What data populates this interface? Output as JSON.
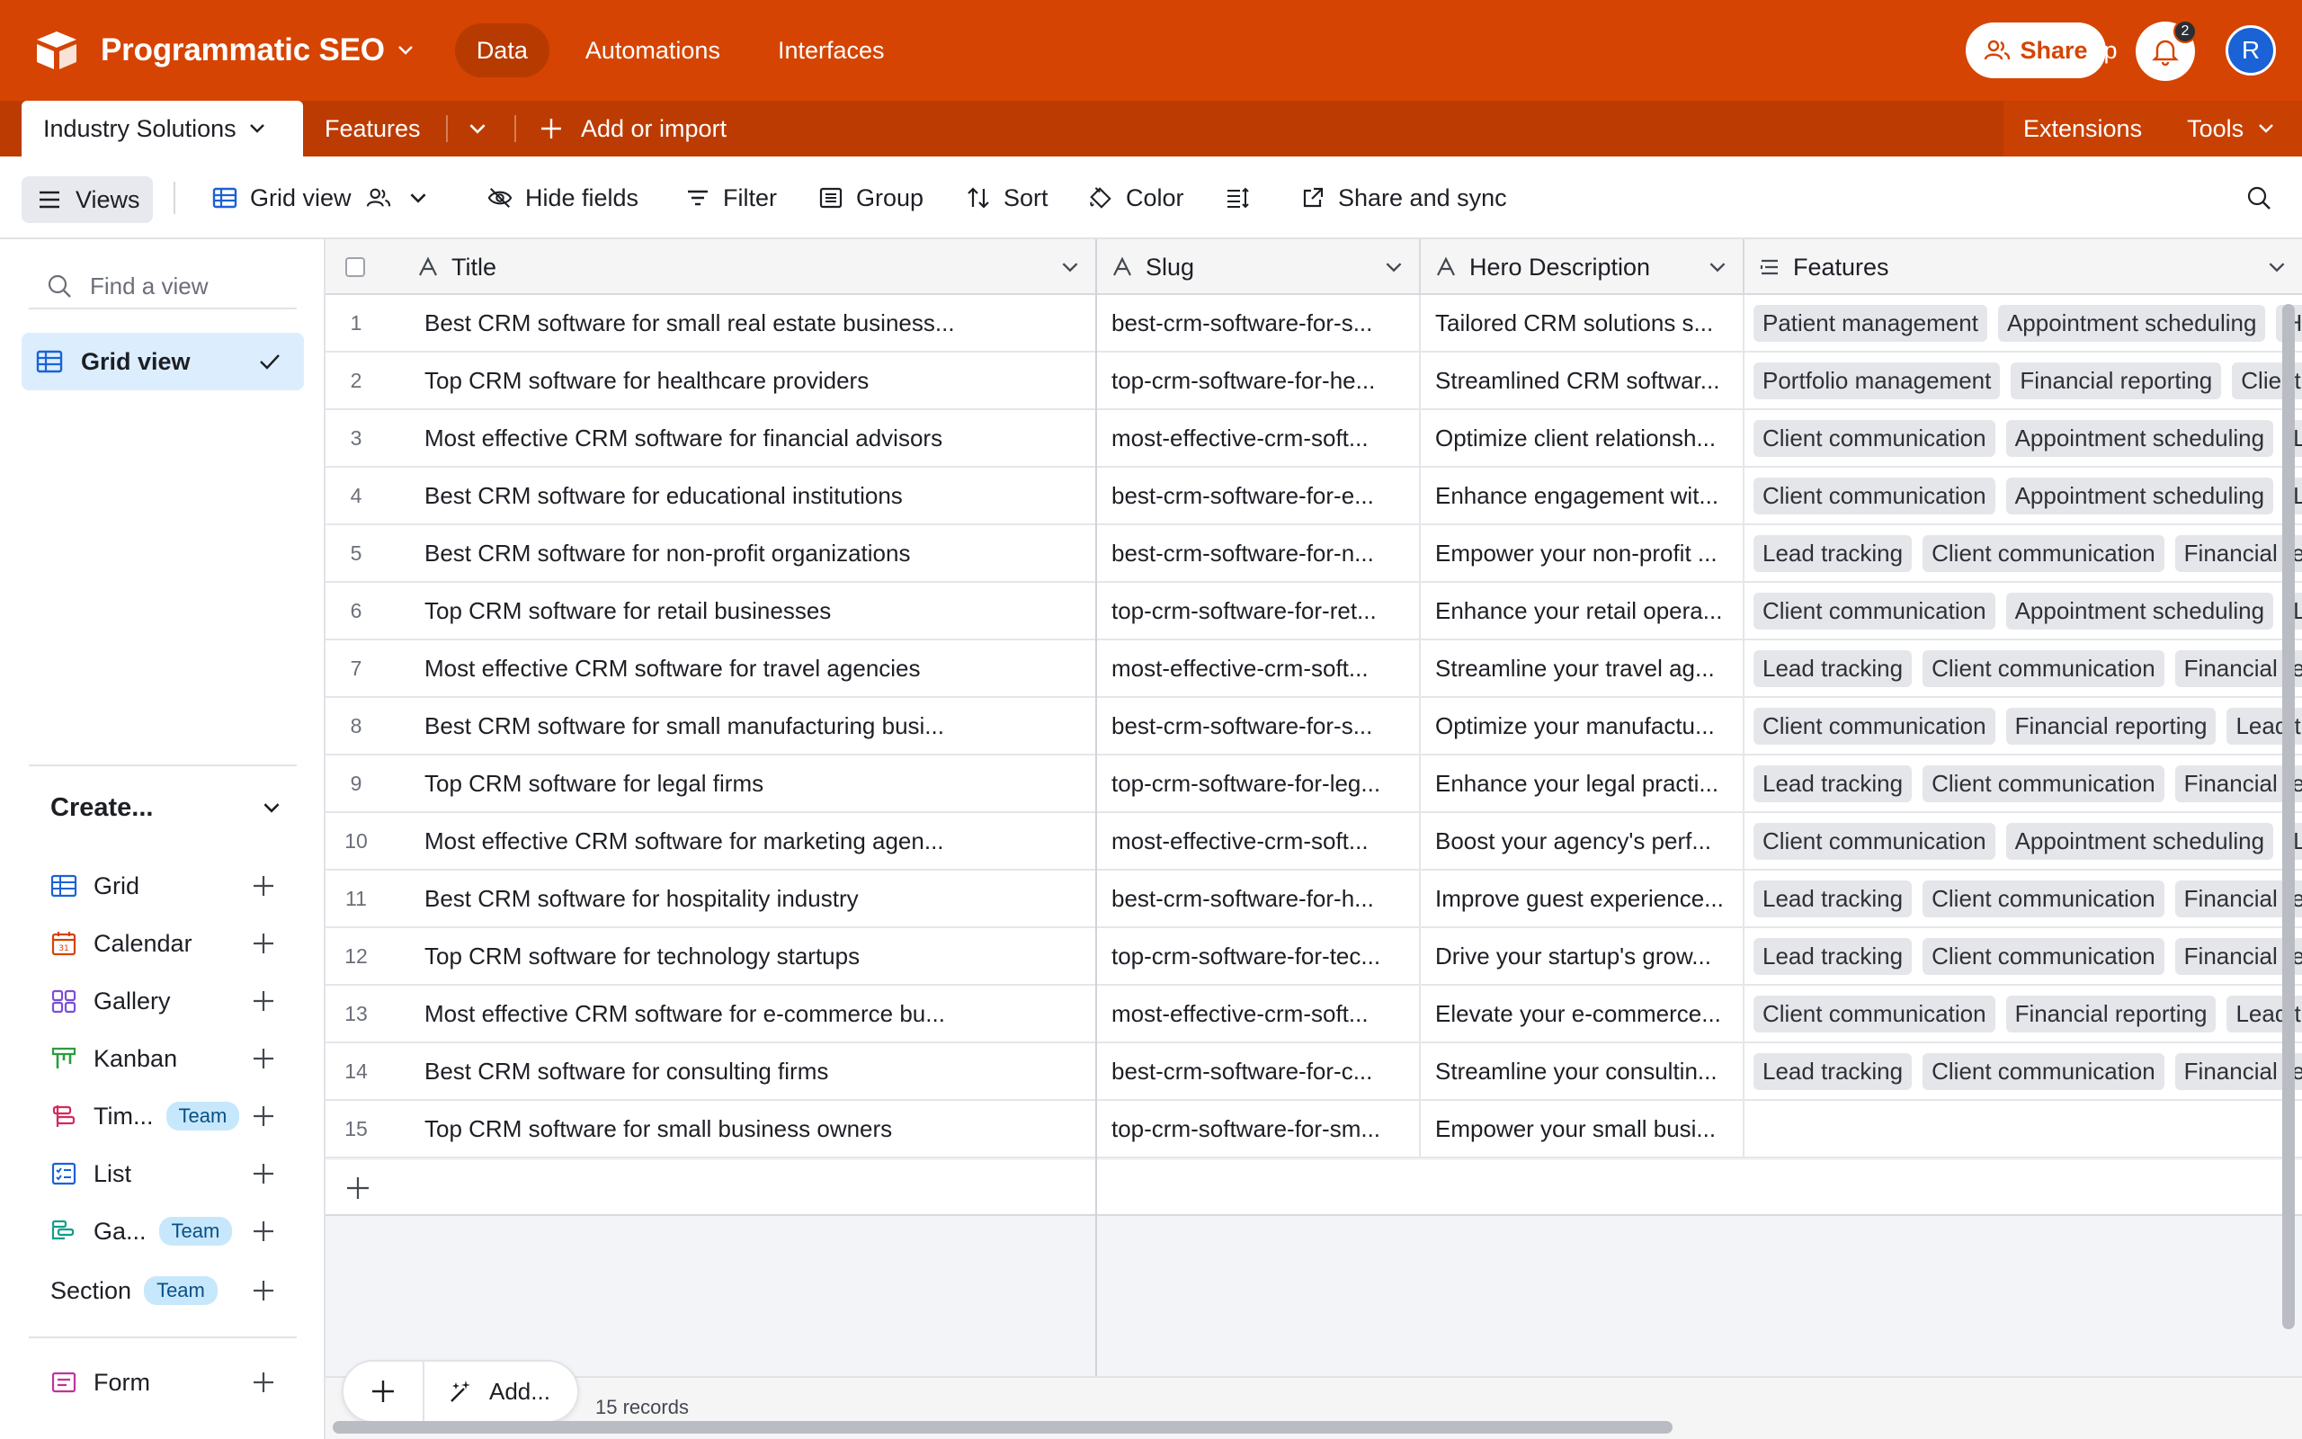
{
  "header": {
    "app_title": "Programmatic SEO",
    "tabs": [
      {
        "label": "Data",
        "active": true
      },
      {
        "label": "Automations",
        "active": false
      },
      {
        "label": "Interfaces",
        "active": false
      }
    ],
    "help_label": "Help",
    "share_label": "Share",
    "notification_count": "2",
    "avatar_initial": "R",
    "brand_color": "#d54402"
  },
  "tablebar": {
    "active_table": "Industry Solutions",
    "other_table": "Features",
    "add_import": "Add or import",
    "extensions": "Extensions",
    "tools": "Tools"
  },
  "viewbar": {
    "views": "Views",
    "view_name": "Grid view",
    "hide_fields": "Hide fields",
    "filter": "Filter",
    "group": "Group",
    "sort": "Sort",
    "color": "Color",
    "share_sync": "Share and sync"
  },
  "sidebar": {
    "find_placeholder": "Find a view",
    "current_view": "Grid view",
    "create_label": "Create...",
    "create_items": [
      {
        "label": "Grid",
        "icon": "grid-icon",
        "team": ""
      },
      {
        "label": "Calendar",
        "icon": "calendar-icon",
        "team": ""
      },
      {
        "label": "Gallery",
        "icon": "gallery-icon",
        "team": ""
      },
      {
        "label": "Kanban",
        "icon": "kanban-icon",
        "team": ""
      },
      {
        "label": "Tim...",
        "icon": "timeline-icon",
        "team": "Team"
      },
      {
        "label": "List",
        "icon": "list-icon",
        "team": ""
      },
      {
        "label": "Ga...",
        "icon": "gantt-icon",
        "team": "Team"
      },
      {
        "label": "Section",
        "icon": "",
        "team": "Team"
      },
      {
        "label": "Form",
        "icon": "form-icon",
        "team": ""
      }
    ]
  },
  "grid": {
    "columns": [
      "Title",
      "Slug",
      "Hero Description",
      "Features"
    ],
    "rows": [
      {
        "n": "1",
        "title": "Best CRM software for small real estate business...",
        "slug": "best-crm-software-for-s...",
        "hero": "Tailored CRM solutions s...",
        "features": [
          "Patient management",
          "Appointment scheduling",
          "HIPAA c"
        ]
      },
      {
        "n": "2",
        "title": "Top CRM software for healthcare providers",
        "slug": "top-crm-software-for-he...",
        "hero": "Streamlined CRM softwar...",
        "features": [
          "Portfolio management",
          "Financial reporting",
          "Client comm"
        ]
      },
      {
        "n": "3",
        "title": "Most effective CRM software for financial advisors",
        "slug": "most-effective-crm-soft...",
        "hero": "Optimize client relationsh...",
        "features": [
          "Client communication",
          "Appointment scheduling",
          "Lead t"
        ]
      },
      {
        "n": "4",
        "title": "Best CRM software for educational institutions",
        "slug": "best-crm-software-for-e...",
        "hero": "Enhance engagement wit...",
        "features": [
          "Client communication",
          "Appointment scheduling",
          "Lead t"
        ]
      },
      {
        "n": "5",
        "title": "Best CRM software for non-profit organizations",
        "slug": "best-crm-software-for-n...",
        "hero": "Empower your non-profit ...",
        "features": [
          "Lead tracking",
          "Client communication",
          "Financial reporti"
        ]
      },
      {
        "n": "6",
        "title": "Top CRM software for retail businesses",
        "slug": "top-crm-software-for-ret...",
        "hero": "Enhance your retail opera...",
        "features": [
          "Client communication",
          "Appointment scheduling",
          "Lead t"
        ]
      },
      {
        "n": "7",
        "title": "Most effective CRM software for travel agencies",
        "slug": "most-effective-crm-soft...",
        "hero": "Streamline your travel ag...",
        "features": [
          "Lead tracking",
          "Client communication",
          "Financial reporti"
        ]
      },
      {
        "n": "8",
        "title": "Best CRM software for small manufacturing busi...",
        "slug": "best-crm-software-for-s...",
        "hero": "Optimize your manufactu...",
        "features": [
          "Client communication",
          "Financial reporting",
          "Lead trackin"
        ]
      },
      {
        "n": "9",
        "title": "Top CRM software for legal firms",
        "slug": "top-crm-software-for-leg...",
        "hero": "Enhance your legal practi...",
        "features": [
          "Lead tracking",
          "Client communication",
          "Financial reporti"
        ]
      },
      {
        "n": "10",
        "title": "Most effective CRM software for marketing agen...",
        "slug": "most-effective-crm-soft...",
        "hero": "Boost your agency's perf...",
        "features": [
          "Client communication",
          "Appointment scheduling",
          "Lead t"
        ]
      },
      {
        "n": "11",
        "title": "Best CRM software for hospitality industry",
        "slug": "best-crm-software-for-h...",
        "hero": "Improve guest experience...",
        "features": [
          "Lead tracking",
          "Client communication",
          "Financial reporti"
        ]
      },
      {
        "n": "12",
        "title": "Top CRM software for technology startups",
        "slug": "top-crm-software-for-tec...",
        "hero": "Drive your startup's grow...",
        "features": [
          "Lead tracking",
          "Client communication",
          "Financial reporti"
        ]
      },
      {
        "n": "13",
        "title": "Most effective CRM software for e-commerce bu...",
        "slug": "most-effective-crm-soft...",
        "hero": "Elevate your e-commerce...",
        "features": [
          "Client communication",
          "Financial reporting",
          "Lead trackin"
        ]
      },
      {
        "n": "14",
        "title": "Best CRM software for consulting firms",
        "slug": "best-crm-software-for-c...",
        "hero": "Streamline your consultin...",
        "features": [
          "Lead tracking",
          "Client communication",
          "Financial reporti"
        ]
      },
      {
        "n": "15",
        "title": "Top CRM software for small business owners",
        "slug": "top-crm-software-for-sm...",
        "hero": "Empower your small busi...",
        "features": []
      }
    ]
  },
  "footer": {
    "add_label": "Add...",
    "record_count": "15 records"
  }
}
